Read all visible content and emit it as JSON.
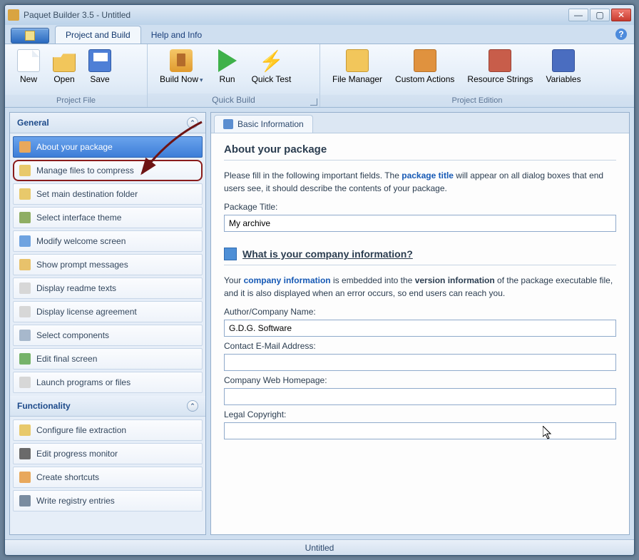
{
  "window": {
    "title": "Paquet Builder 3.5 - Untitled"
  },
  "tabs": {
    "project": "Project and Build",
    "help": "Help and Info"
  },
  "ribbon": {
    "new": "New",
    "open": "Open",
    "save": "Save",
    "build": "Build Now",
    "run": "Run",
    "quicktest": "Quick Test",
    "fileman": "File Manager",
    "custact": "Custom Actions",
    "resstr": "Resource Strings",
    "vars": "Variables",
    "grp_projectfile": "Project File",
    "grp_quickbuild": "Quick Build",
    "grp_edition": "Project Edition"
  },
  "sidebar": {
    "general_header": "General",
    "func_header": "Functionality",
    "general": [
      "About your package",
      "Manage files to compress",
      "Set main destination folder",
      "Select interface theme",
      "Modify welcome screen",
      "Show prompt messages",
      "Display readme texts",
      "Display license agreement",
      "Select components",
      "Edit final screen",
      "Launch programs or files"
    ],
    "functionality": [
      "Configure file extraction",
      "Edit progress monitor",
      "Create shortcuts",
      "Write registry entries"
    ]
  },
  "content": {
    "tab": "Basic Information",
    "heading": "About your package",
    "intro_a": "Please fill in the following important fields. The ",
    "intro_link": "package title",
    "intro_b": " will appear on all dialog boxes that end users see, it should describe the contents of your package.",
    "pkg_title_label": "Package Title:",
    "pkg_title_value": "My archive",
    "company_heading": "What is your company information?",
    "company_a": "Your ",
    "company_link": "company information",
    "company_b": " is embedded into the ",
    "company_bold": "version information",
    "company_c": " of the package executable file, and it is also displayed when an error occurs, so end users can reach you.",
    "author_label": "Author/Company Name:",
    "author_value": "G.D.G. Software",
    "email_label": "Contact E-Mail Address:",
    "email_value": "",
    "web_label": "Company Web Homepage:",
    "web_value": "",
    "legal_label": "Legal Copyright:",
    "legal_value": ""
  },
  "statusbar": {
    "text": "Untitled"
  }
}
